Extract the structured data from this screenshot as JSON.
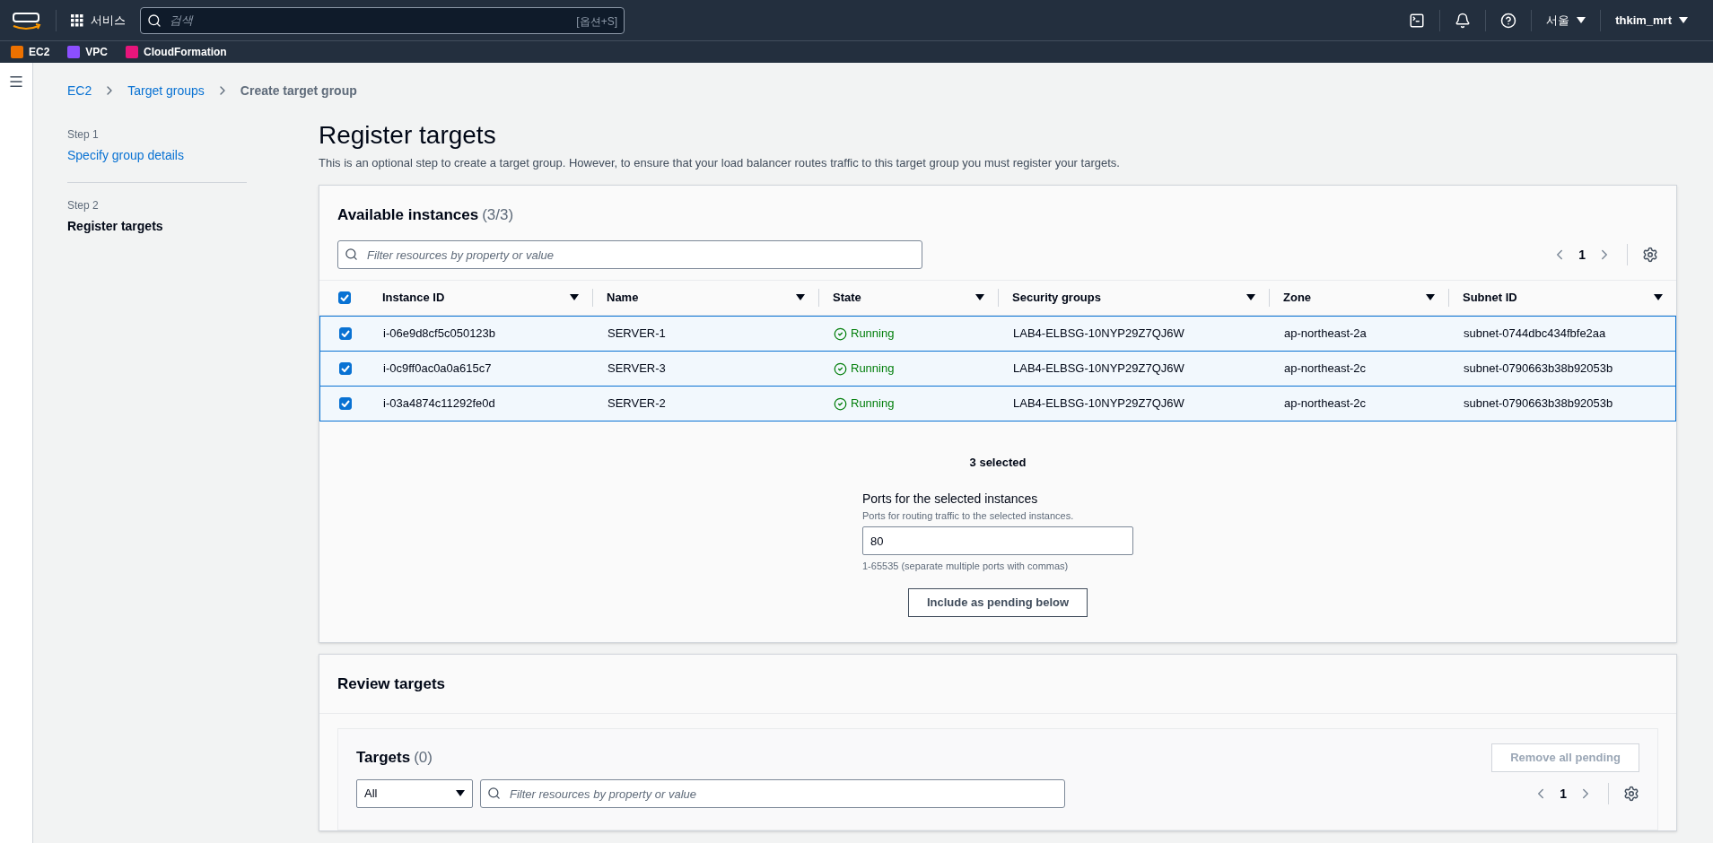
{
  "top_nav": {
    "services": "서비스",
    "search": {
      "placeholder": "검색",
      "shortcut": "[옵션+S]"
    },
    "region": "서울",
    "user": "thkim_mrt"
  },
  "favorites": [
    {
      "label": "EC2",
      "color": "#ed7100"
    },
    {
      "label": "VPC",
      "color": "#8c4fff"
    },
    {
      "label": "CloudFormation",
      "color": "#e7157b"
    }
  ],
  "breadcrumb": [
    {
      "label": "EC2",
      "link": true
    },
    {
      "label": "Target groups",
      "link": true
    },
    {
      "label": "Create target group",
      "link": false
    }
  ],
  "steps": [
    {
      "step": "Step 1",
      "label": "Specify group details",
      "selected": false
    },
    {
      "step": "Step 2",
      "label": "Register targets",
      "selected": true
    }
  ],
  "page": {
    "title": "Register targets",
    "description": "This is an optional step to create a target group. However, to ensure that your load balancer routes traffic to this target group you must register your targets."
  },
  "available_instances": {
    "title": "Available instances",
    "count": "(3/3)",
    "filter_placeholder": "Filter resources by property or value",
    "page": "1",
    "all_checked": true,
    "columns": [
      "Instance ID",
      "Name",
      "State",
      "Security groups",
      "Zone",
      "Subnet ID"
    ],
    "rows": [
      {
        "checked": true,
        "instance_id": "i-06e9d8cf5c050123b",
        "name": "SERVER-1",
        "state": "Running",
        "security_groups": "LAB4-ELBSG-10NYP29Z7QJ6W",
        "zone": "ap-northeast-2a",
        "subnet_id": "subnet-0744dbc434fbfe2aa"
      },
      {
        "checked": true,
        "instance_id": "i-0c9ff0ac0a0a615c7",
        "name": "SERVER-3",
        "state": "Running",
        "security_groups": "LAB4-ELBSG-10NYP29Z7QJ6W",
        "zone": "ap-northeast-2c",
        "subnet_id": "subnet-0790663b38b92053b"
      },
      {
        "checked": true,
        "instance_id": "i-03a4874c11292fe0d",
        "name": "SERVER-2",
        "state": "Running",
        "security_groups": "LAB4-ELBSG-10NYP29Z7QJ6W",
        "zone": "ap-northeast-2c",
        "subnet_id": "subnet-0790663b38b92053b"
      }
    ],
    "selected_count": "3 selected",
    "ports": {
      "label": "Ports for the selected instances",
      "description": "Ports for routing traffic to the selected instances.",
      "value": "80",
      "hint": "1-65535 (separate multiple ports with commas)"
    },
    "include_button": "Include as pending below"
  },
  "review_targets": {
    "title": "Review targets",
    "targets_title": "Targets",
    "count": "(0)",
    "remove_button": {
      "label": "Remove all pending",
      "disabled": true
    },
    "filter_select": "All",
    "filter_placeholder": "Filter resources by property or value",
    "page": "1"
  }
}
